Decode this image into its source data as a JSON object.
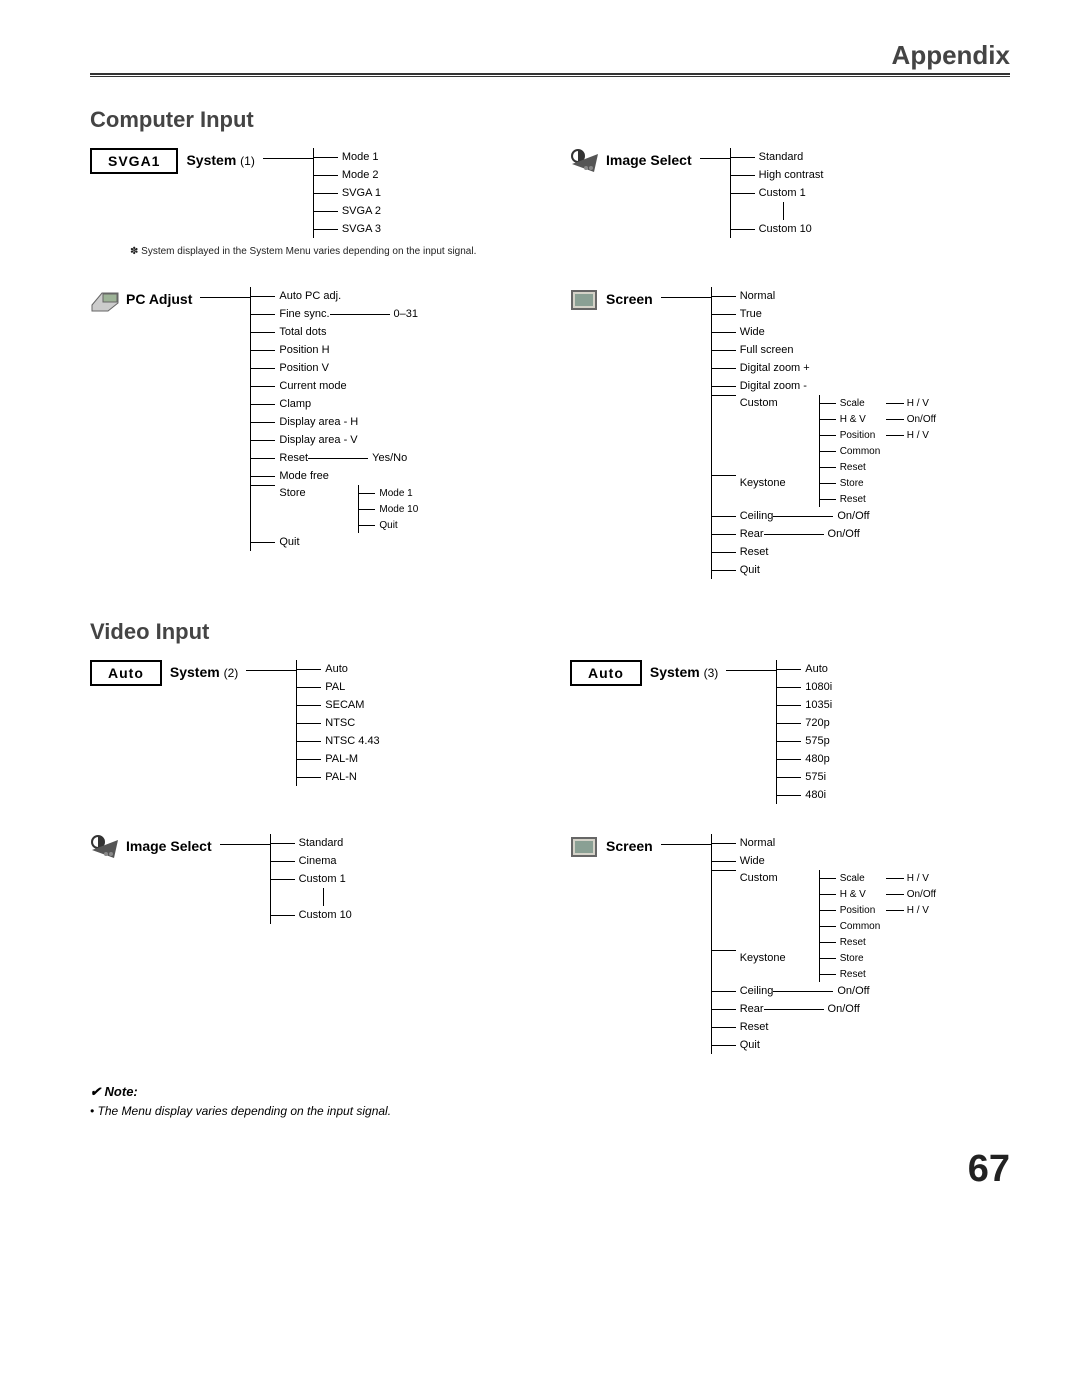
{
  "header": "Appendix",
  "page_number": "67",
  "sections": {
    "computer_input": {
      "title": "Computer Input",
      "system": {
        "box_label": "SVGA1",
        "title": "System",
        "num": "(1)",
        "items": [
          "Mode 1",
          "Mode 2",
          "SVGA 1",
          "SVGA 2",
          "SVGA 3"
        ],
        "footnote_prefix": "✽",
        "footnote": "System displayed in the System Menu varies depending on the input signal."
      },
      "image_select": {
        "title": "Image Select",
        "items": [
          "Standard",
          "High contrast",
          "Custom 1",
          "Custom 10"
        ]
      },
      "pc_adjust": {
        "title": "PC Adjust",
        "items": [
          {
            "label": "Auto PC adj."
          },
          {
            "label": "Fine sync.",
            "right": "0–31"
          },
          {
            "label": "Total dots"
          },
          {
            "label": "Position H"
          },
          {
            "label": "Position V"
          },
          {
            "label": "Current mode"
          },
          {
            "label": "Clamp"
          },
          {
            "label": "Display area - H"
          },
          {
            "label": "Display area - V"
          },
          {
            "label": "Reset",
            "right": "Yes/No"
          },
          {
            "label": "Mode free"
          },
          {
            "label": "Store",
            "sub": [
              "Mode 1",
              "Mode 10",
              "Quit"
            ]
          },
          {
            "label": "Quit"
          }
        ]
      },
      "screen": {
        "title": "Screen",
        "items": [
          {
            "label": "Normal"
          },
          {
            "label": "True"
          },
          {
            "label": "Wide"
          },
          {
            "label": "Full screen"
          },
          {
            "label": "Digital zoom +"
          },
          {
            "label": "Digital zoom -"
          },
          {
            "label": "Custom",
            "sub": [
              {
                "label": "Scale",
                "right": "H / V"
              },
              {
                "label": "H & V",
                "right": "On/Off"
              },
              {
                "label": "Position",
                "right": "H / V"
              },
              {
                "label": "Common"
              },
              {
                "label": "Reset"
              }
            ]
          },
          {
            "label": "Keystone",
            "sub": [
              {
                "label": "Store"
              },
              {
                "label": "Reset"
              }
            ]
          },
          {
            "label": "Ceiling",
            "right": "On/Off"
          },
          {
            "label": "Rear",
            "right": "On/Off"
          },
          {
            "label": "Reset"
          },
          {
            "label": "Quit"
          }
        ]
      }
    },
    "video_input": {
      "title": "Video Input",
      "system2": {
        "box_label": "Auto",
        "title": "System",
        "num": "(2)",
        "items": [
          "Auto",
          "PAL",
          "SECAM",
          "NTSC",
          "NTSC 4.43",
          "PAL-M",
          "PAL-N"
        ]
      },
      "system3": {
        "box_label": "Auto",
        "title": "System",
        "num": "(3)",
        "items": [
          "Auto",
          "1080i",
          "1035i",
          "720p",
          "575p",
          "480p",
          "575i",
          "480i"
        ]
      },
      "image_select": {
        "title": "Image Select",
        "items": [
          "Standard",
          "Cinema",
          "Custom 1",
          "Custom 10"
        ]
      },
      "screen": {
        "title": "Screen",
        "items": [
          {
            "label": "Normal"
          },
          {
            "label": "Wide"
          },
          {
            "label": "Custom",
            "sub": [
              {
                "label": "Scale",
                "right": "H / V"
              },
              {
                "label": "H & V",
                "right": "On/Off"
              },
              {
                "label": "Position",
                "right": "H / V"
              },
              {
                "label": "Common"
              },
              {
                "label": "Reset"
              }
            ]
          },
          {
            "label": "Keystone",
            "sub": [
              {
                "label": "Store"
              },
              {
                "label": "Reset"
              }
            ]
          },
          {
            "label": "Ceiling",
            "right": "On/Off"
          },
          {
            "label": "Rear",
            "right": "On/Off"
          },
          {
            "label": "Reset"
          },
          {
            "label": "Quit"
          }
        ]
      }
    }
  },
  "note": {
    "title": "Note:",
    "check": "✔",
    "body": "• The Menu display varies depending on the input signal."
  }
}
